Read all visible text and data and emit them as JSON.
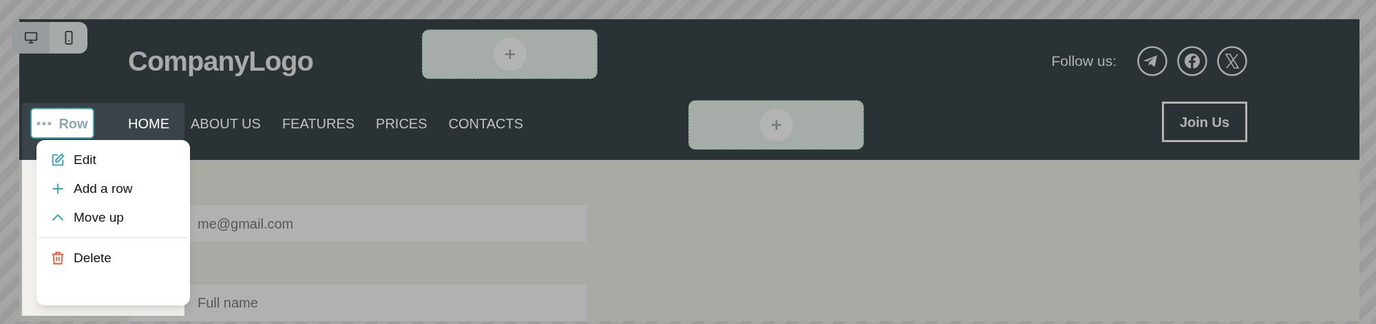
{
  "device_toggle": [
    {
      "kind": "desktop",
      "selected": true
    },
    {
      "kind": "mobile",
      "selected": false
    }
  ],
  "header": {
    "logo": "CompanyLogo",
    "follow_label": "Follow us:",
    "social": [
      {
        "kind": "telegram"
      },
      {
        "kind": "facebook"
      },
      {
        "kind": "x"
      }
    ],
    "nav": [
      {
        "label": "HOME",
        "selected": true
      },
      {
        "label": "ABOUT US",
        "selected": false
      },
      {
        "label": "FEATURES",
        "selected": false
      },
      {
        "label": "PRICES",
        "selected": false
      },
      {
        "label": "CONTACTS",
        "selected": false
      }
    ],
    "cta": "Join Us"
  },
  "row_button": {
    "label": "Row"
  },
  "row_menu": [
    {
      "kind": "edit",
      "label": "Edit"
    },
    {
      "kind": "add",
      "label": "Add a row"
    },
    {
      "kind": "move_up",
      "label": "Move up"
    },
    {
      "kind": "delete",
      "label": "Delete"
    }
  ],
  "form_fields": [
    {
      "placeholder": "me@gmail.com"
    },
    {
      "placeholder": "Full name"
    }
  ]
}
